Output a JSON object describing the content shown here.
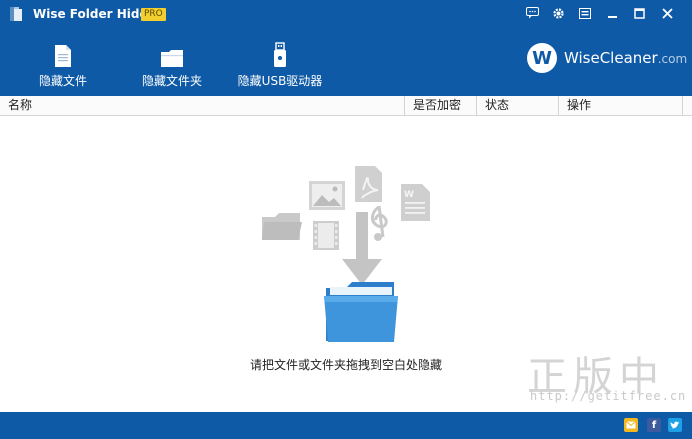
{
  "window": {
    "title": "Wise Folder Hider",
    "badge": "PRO"
  },
  "titlebar_buttons": [
    "chat-icon",
    "gear-icon",
    "menu-icon",
    "minimize-icon",
    "maximize-icon",
    "close-icon"
  ],
  "toolbar": {
    "hide_file": "隐藏文件",
    "hide_folder": "隐藏文件夹",
    "hide_usb": "隐藏USB驱动器"
  },
  "brand": {
    "logo_letter": "W",
    "name": "WiseCleaner",
    "domain": ".com"
  },
  "columns": {
    "name": "名称",
    "encrypted": "是否加密",
    "status": "状态",
    "actions": "操作"
  },
  "main": {
    "drop_hint": "请把文件或文件夹拖拽到空白处隐藏"
  },
  "watermark": {
    "text": "正版中国",
    "url": "http://getitfree.cn"
  },
  "colors": {
    "primary": "#0f5aa6",
    "badge": "#f2cf2f",
    "folder_blue": "#3a8fd8",
    "gray_icon": "#c4c4c4"
  }
}
